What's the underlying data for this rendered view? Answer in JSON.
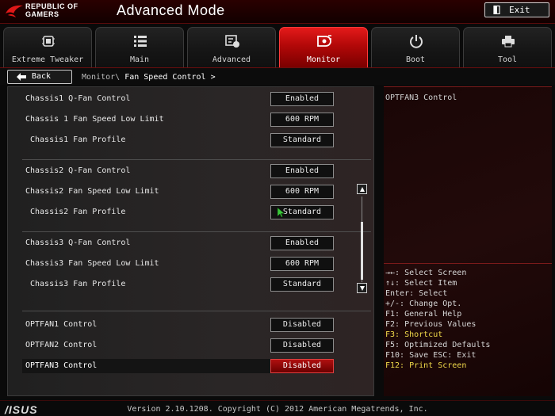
{
  "header": {
    "brand_line1": "REPUBLIC OF",
    "brand_line2": "GAMERS",
    "title": "Advanced Mode",
    "exit_label": "Exit"
  },
  "tabs": [
    {
      "label": "Extreme Tweaker",
      "icon": "tweaker-icon",
      "active": false
    },
    {
      "label": "Main",
      "icon": "list-icon",
      "active": false
    },
    {
      "label": "Advanced",
      "icon": "advanced-icon",
      "active": false
    },
    {
      "label": "Monitor",
      "icon": "monitor-icon",
      "active": true
    },
    {
      "label": "Boot",
      "icon": "power-icon",
      "active": false
    },
    {
      "label": "Tool",
      "icon": "printer-icon",
      "active": false
    }
  ],
  "breadcrumb": {
    "back_label": "Back",
    "path": "Monitor\\",
    "current": "Fan Speed Control >"
  },
  "settings": [
    {
      "label": "Chassis1 Q-Fan Control",
      "value": "Enabled"
    },
    {
      "label": "Chassis 1 Fan Speed Low Limit",
      "value": "600 RPM"
    },
    {
      "label": "Chassis1 Fan Profile",
      "value": "Standard"
    },
    {
      "label": "Chassis2 Q-Fan Control",
      "value": "Enabled"
    },
    {
      "label": "Chassis2 Fan Speed Low Limit",
      "value": "600 RPM"
    },
    {
      "label": "Chassis2 Fan Profile",
      "value": "Standard"
    },
    {
      "label": "Chassis3 Q-Fan Control",
      "value": "Enabled"
    },
    {
      "label": "Chassis3 Fan Speed Low Limit",
      "value": "600 RPM"
    },
    {
      "label": "Chassis3 Fan Profile",
      "value": "Standard"
    },
    {
      "label": "OPTFAN1 Control",
      "value": "Disabled"
    },
    {
      "label": "OPTFAN2 Control",
      "value": "Disabled"
    },
    {
      "label": "OPTFAN3 Control",
      "value": "Disabled"
    }
  ],
  "help": {
    "title": "OPTFAN3 Control",
    "keys": [
      "→←: Select Screen",
      "↑↓: Select Item",
      "Enter: Select",
      "+/-: Change Opt.",
      "F1: General Help",
      "F2: Previous Values",
      "F3: Shortcut",
      "F5: Optimized Defaults",
      "F10: Save  ESC: Exit",
      "F12: Print Screen"
    ]
  },
  "footer": {
    "brand": "/ISUS",
    "version": "Version 2.10.1208. Copyright (C) 2012 American Megatrends, Inc."
  },
  "colors": {
    "accent": "#c00000",
    "highlight_key": "#f0d94a"
  }
}
